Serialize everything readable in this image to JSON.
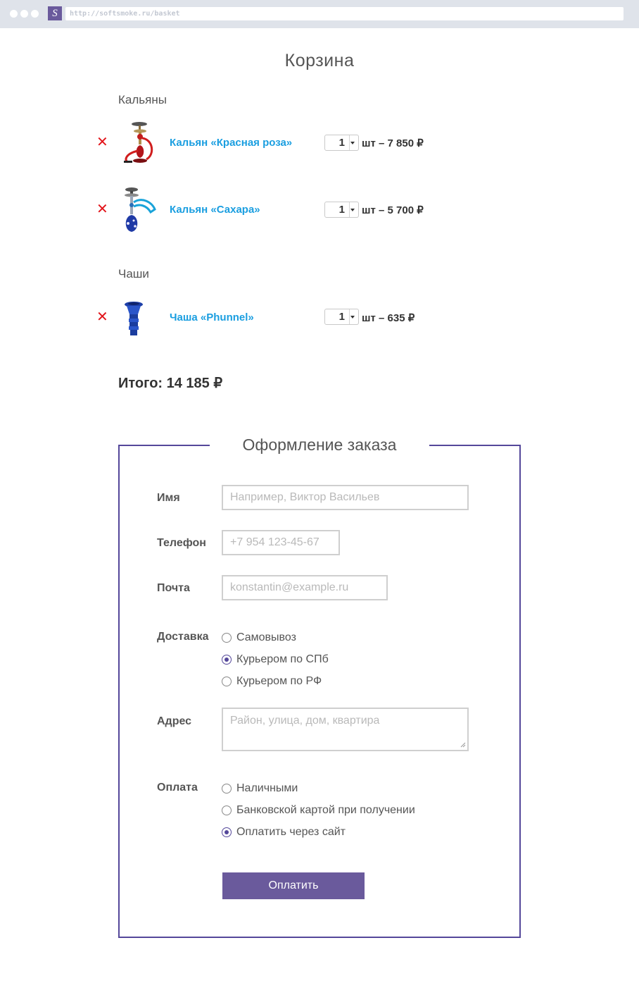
{
  "browser": {
    "favicon_letter": "S",
    "url": "http://softsmoke.ru/basket"
  },
  "page_title": "Корзина",
  "categories": [
    {
      "name": "Кальяны",
      "items": [
        {
          "name": "Кальян «Красная роза»",
          "qty": "1",
          "price": "шт – 7 850 ₽",
          "icon": "hookah-red-image"
        },
        {
          "name": "Кальян «Сахара»",
          "qty": "1",
          "price": "шт – 5 700 ₽",
          "icon": "hookah-blue-image"
        }
      ]
    },
    {
      "name": "Чаши",
      "items": [
        {
          "name": "Чаша «Phunnel»",
          "qty": "1",
          "price": "шт – 635 ₽",
          "icon": "bowl-blue-image"
        }
      ]
    }
  ],
  "total": "Итого: 14 185 ₽",
  "order": {
    "title": "Оформление заказа",
    "name_label": "Имя",
    "name_placeholder": "Например, Виктор Васильев",
    "phone_label": "Телефон",
    "phone_placeholder": "+7 954 123-45-67",
    "email_label": "Почта",
    "email_placeholder": "konstantin@example.ru",
    "delivery_label": "Доставка",
    "delivery_options": [
      {
        "label": "Самовывоз",
        "checked": false
      },
      {
        "label": "Курьером по СПб",
        "checked": true
      },
      {
        "label": "Курьером по РФ",
        "checked": false
      }
    ],
    "address_label": "Адрес",
    "address_placeholder": "Район, улица, дом, квартира",
    "payment_label": "Оплата",
    "payment_options": [
      {
        "label": "Наличными",
        "checked": false
      },
      {
        "label": "Банковской картой при получении",
        "checked": false
      },
      {
        "label": "Оплатить через сайт",
        "checked": true
      }
    ],
    "submit_label": "Оплатить"
  },
  "colors": {
    "accent": "#54479a",
    "button": "#6a5a9c",
    "link": "#1a9ee0",
    "remove": "#e2151b"
  }
}
